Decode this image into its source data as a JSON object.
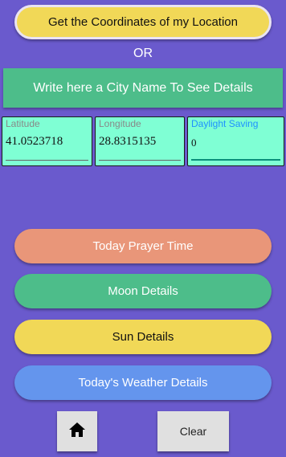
{
  "header": {
    "coords_button": "Get the Coordinates of my Location",
    "or_text": "OR",
    "city_placeholder": "Write here a City Name To See Details"
  },
  "fields": {
    "latitude": {
      "label": "Latitude",
      "value": "41.0523718"
    },
    "longitude": {
      "label": "Longitude",
      "value": "28.8315135"
    },
    "daylight_saving": {
      "label": "Daylight Saving",
      "value": "0"
    }
  },
  "actions": {
    "prayer": "Today Prayer Time",
    "moon": "Moon Details",
    "sun": "Sun Details",
    "weather": "Today's Weather Details"
  },
  "bottom_bar": {
    "home_icon": "home-icon",
    "clear": "Clear"
  },
  "colors": {
    "background": "#6a5acd",
    "yellow": "#f1d857",
    "green": "#4dbd8a",
    "salmon": "#e99679",
    "blue": "#6495ed",
    "aquamarine": "#7fffd4",
    "accent_label": "#1e90ff"
  }
}
